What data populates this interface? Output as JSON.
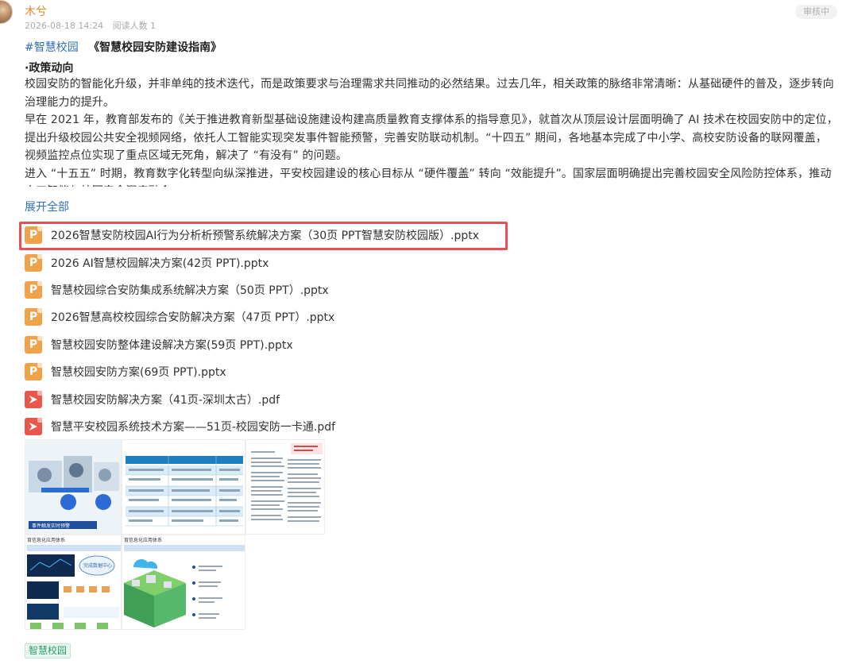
{
  "author": {
    "name": "木兮"
  },
  "meta": {
    "date": "2026-08-18 14:24",
    "views": "阅读人数 1"
  },
  "status_badge": "审核中",
  "post": {
    "hashtag": "#智慧校园",
    "book_title": "《智慧校园安防建设指南》",
    "section_head": "·政策动向",
    "paragraphs": [
      "校园安防的智能化升级，并非单纯的技术迭代，而是政策要求与治理需求共同推动的必然结果。过去几年，相关政策的脉络非常清晰：从基础硬件的普及，逐步转向治理能力的提升。",
      "早在 2021 年，教育部发布的《关于推进教育新型基础设施建设构建高质量教育支撑体系的指导意见》，就首次从顶层设计层面明确了 AI 技术在校园安防中的定位，提出升级校园公共安全视频网络，依托人工智能实现突发事件智能预警，完善安防联动机制。“十四五” 期间，各地基本完成了中小学、高校安防设备的联网覆盖，视频监控点位实现了重点区域无死角，解决了 “有没有” 的问题。",
      "进入 “十五五” 时期，教育数字化转型向纵深推进，平安校园建设的核心目标从 “硬件覆盖” 转向 “效能提升”。国家层面明确提出完善校园安全风险防控体系，推动人工智能与校园安全深度融合。"
    ],
    "expand_label": "展开全部"
  },
  "files": [
    {
      "type": "ppt",
      "name": "2026智慧安防校园AI行为分析析预警系统解决方案（30页 PPT智慧安防校园版）.pptx",
      "highlighted": true
    },
    {
      "type": "ppt",
      "name": "2026 AI智慧校园解决方案(42页 PPT).pptx"
    },
    {
      "type": "ppt",
      "name": "智慧校园综合安防集成系统解决方案（50页 PPT）.pptx"
    },
    {
      "type": "ppt",
      "name": "2026智慧高校校园综合安防解决方案（47页 PPT）.pptx"
    },
    {
      "type": "ppt",
      "name": "智慧校园安防整体建设解决方案(59页 PPT).pptx"
    },
    {
      "type": "ppt",
      "name": "智慧校园安防方案(69页 PPT).pptx"
    },
    {
      "type": "pdf",
      "name": "智慧校园安防解决方案（41页-深圳太古）.pdf"
    },
    {
      "type": "pdf",
      "name": "智慧平安校园系统技术方案——51页-校园安防一卡通.pdf"
    }
  ],
  "icons": {
    "ppt": "ppt-file-icon",
    "pdf": "pdf-file-icon"
  },
  "colors": {
    "accent_link": "#2f6fb8",
    "author": "#e08a1e",
    "highlight": "#e84f52",
    "tag": "#2b9c6c"
  },
  "thumbnails": {
    "t1": {
      "caption": "事件触发实时预警"
    },
    "t4": {
      "heading": "育信息化应用体系",
      "center": "完成数据中心"
    },
    "t5": {
      "heading": "育信息化应用体系"
    }
  },
  "tag": "智慧校园"
}
